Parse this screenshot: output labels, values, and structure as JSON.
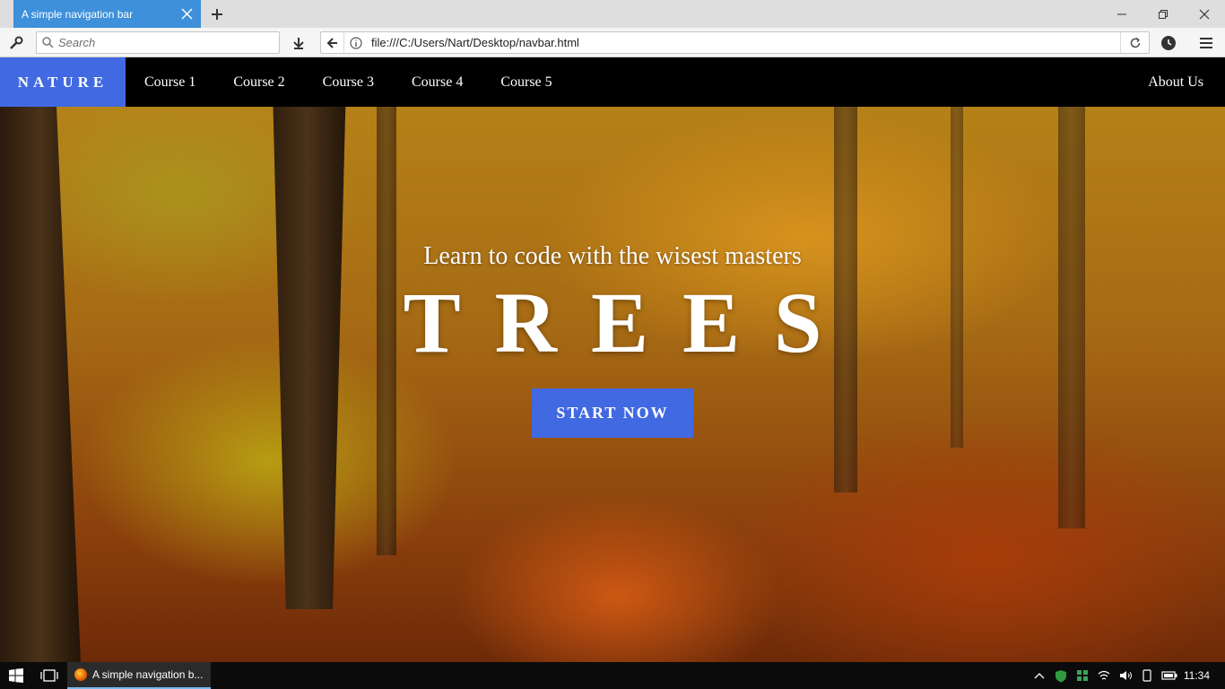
{
  "browser": {
    "tab_title": "A simple navigation bar",
    "search_placeholder": "Search",
    "url": "file:///C:/Users/Nart/Desktop/navbar.html"
  },
  "site": {
    "brand": "NATURE",
    "nav_items": [
      "Course 1",
      "Course 2",
      "Course 3",
      "Course 4",
      "Course 5"
    ],
    "about": "About Us",
    "hero_subtitle": "Learn to code with the wisest masters",
    "hero_title": "TREES",
    "cta": "START NOW",
    "accent_color": "#4169e1"
  },
  "taskbar": {
    "app_label": "A simple navigation b...",
    "time": "11:34"
  }
}
